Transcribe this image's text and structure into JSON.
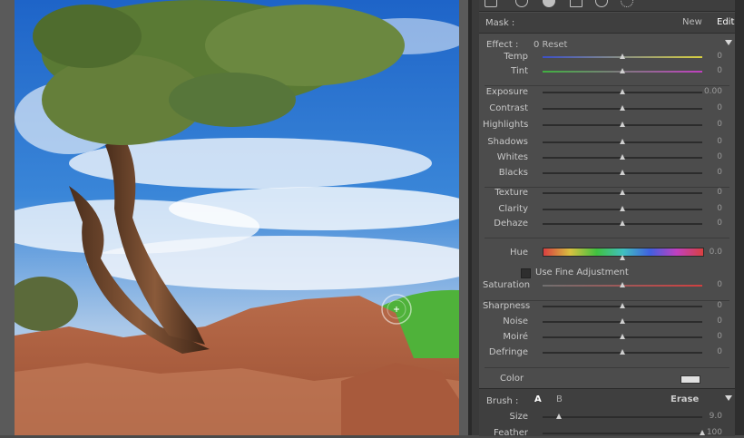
{
  "mask": {
    "label": "Mask :",
    "new": "New",
    "edit": "Edit"
  },
  "effect": {
    "label": "Effect :",
    "value": "0 Reset"
  },
  "sliders": [
    {
      "key": "temp",
      "label": "Temp",
      "value": "0",
      "pos": 0.5,
      "kind": "temp"
    },
    {
      "key": "tint",
      "label": "Tint",
      "value": "0",
      "pos": 0.5,
      "kind": "tint"
    },
    {
      "key": "exposure",
      "label": "Exposure",
      "value": "0.00",
      "pos": 0.5
    },
    {
      "key": "contrast",
      "label": "Contrast",
      "value": "0",
      "pos": 0.5
    },
    {
      "key": "highlights",
      "label": "Highlights",
      "value": "0",
      "pos": 0.5
    },
    {
      "key": "shadows",
      "label": "Shadows",
      "value": "0",
      "pos": 0.5
    },
    {
      "key": "whites",
      "label": "Whites",
      "value": "0",
      "pos": 0.5
    },
    {
      "key": "blacks",
      "label": "Blacks",
      "value": "0",
      "pos": 0.5
    },
    {
      "key": "texture",
      "label": "Texture",
      "value": "0",
      "pos": 0.5
    },
    {
      "key": "clarity",
      "label": "Clarity",
      "value": "0",
      "pos": 0.5
    },
    {
      "key": "dehaze",
      "label": "Dehaze",
      "value": "0",
      "pos": 0.5
    },
    {
      "key": "saturation",
      "label": "Saturation",
      "value": "0",
      "pos": 0.5,
      "kind": "sat"
    },
    {
      "key": "sharpness",
      "label": "Sharpness",
      "value": "0",
      "pos": 0.5
    },
    {
      "key": "noise",
      "label": "Noise",
      "value": "0",
      "pos": 0.5
    },
    {
      "key": "moire",
      "label": "Moiré",
      "value": "0",
      "pos": 0.5
    },
    {
      "key": "defringe",
      "label": "Defringe",
      "value": "0",
      "pos": 0.5
    }
  ],
  "hue": {
    "label": "Hue",
    "value": "0.0",
    "pos": 0.5
  },
  "fine": {
    "label": "Use Fine Adjustment"
  },
  "color": {
    "label": "Color"
  },
  "brush": {
    "label": "Brush :",
    "a": "A",
    "b": "B",
    "erase": "Erase"
  },
  "brush_sliders": [
    {
      "key": "size",
      "label": "Size",
      "value": "9.0",
      "pos": 0.1
    },
    {
      "key": "feather",
      "label": "Feather",
      "value": "100",
      "pos": 1.0
    }
  ]
}
